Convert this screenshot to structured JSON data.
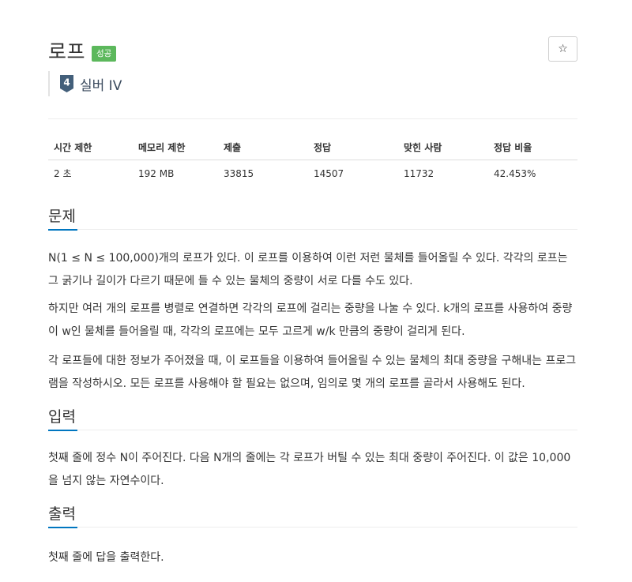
{
  "problem": {
    "title": "로프",
    "status_badge": "성공",
    "star_icon": "☆",
    "tier_level": "4",
    "tier_label": "실버 IV",
    "tier_color": "#435f7a"
  },
  "info_table": {
    "headers": [
      "시간 제한",
      "메모리 제한",
      "제출",
      "정답",
      "맞힌 사람",
      "정답 비율"
    ],
    "values": [
      "2 초",
      "192 MB",
      "33815",
      "14507",
      "11732",
      "42.453%"
    ]
  },
  "sections": {
    "description": {
      "heading": "문제",
      "paragraphs": [
        "N(1 ≤ N ≤ 100,000)개의 로프가 있다. 이 로프를 이용하여 이런 저런 물체를 들어올릴 수 있다. 각각의 로프는 그 굵기나 길이가 다르기 때문에 들 수 있는 물체의 중량이 서로 다를 수도 있다.",
        "하지만 여러 개의 로프를 병렬로 연결하면 각각의 로프에 걸리는 중량을 나눌 수 있다. k개의 로프를 사용하여 중량이 w인 물체를 들어올릴 때, 각각의 로프에는 모두 고르게 w/k 만큼의 중량이 걸리게 된다.",
        "각 로프들에 대한 정보가 주어졌을 때, 이 로프들을 이용하여 들어올릴 수 있는 물체의 최대 중량을 구해내는 프로그램을 작성하시오. 모든 로프를 사용해야 할 필요는 없으며, 임의로 몇 개의 로프를 골라서 사용해도 된다."
      ]
    },
    "input": {
      "heading": "입력",
      "paragraphs": [
        "첫째 줄에 정수 N이 주어진다. 다음 N개의 줄에는 각 로프가 버틸 수 있는 최대 중량이 주어진다. 이 값은 10,000을 넘지 않는 자연수이다."
      ]
    },
    "output": {
      "heading": "출력",
      "paragraphs": [
        "첫째 줄에 답을 출력한다."
      ]
    }
  },
  "colors": {
    "success_badge": "#5cb85c",
    "section_underline": "#0076c0"
  }
}
